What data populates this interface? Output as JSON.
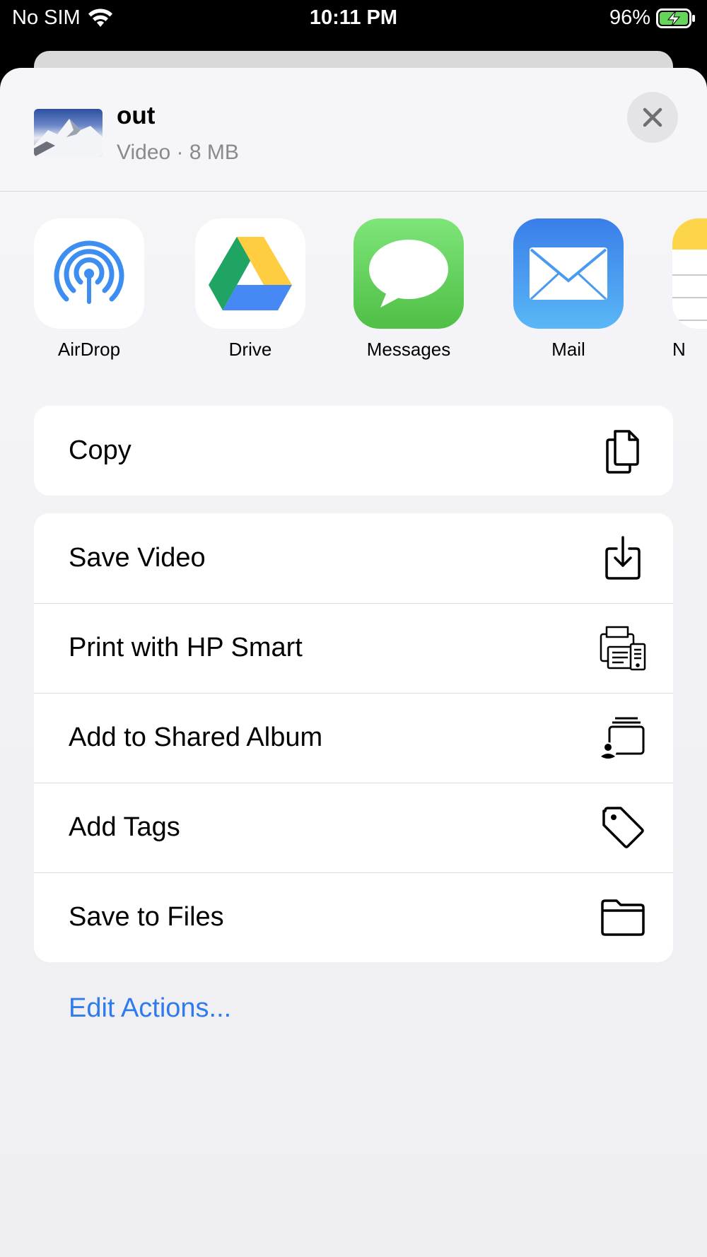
{
  "status_bar": {
    "carrier": "No SIM",
    "time": "10:11 PM",
    "battery": "96%",
    "icons": [
      "wifi-icon",
      "battery-charging-icon"
    ]
  },
  "file": {
    "title": "out",
    "meta": "Video · 8 MB"
  },
  "apps": [
    {
      "label": "AirDrop",
      "icon": "airdrop-icon"
    },
    {
      "label": "Drive",
      "icon": "google-drive-icon"
    },
    {
      "label": "Messages",
      "icon": "messages-icon"
    },
    {
      "label": "Mail",
      "icon": "mail-icon"
    },
    {
      "label": "N",
      "icon": "notes-icon"
    }
  ],
  "actions_primary": [
    {
      "label": "Copy",
      "icon": "copy-icon"
    }
  ],
  "actions_secondary": [
    {
      "label": "Save Video",
      "icon": "download-icon"
    },
    {
      "label": "Print with HP Smart",
      "icon": "printer-icon"
    },
    {
      "label": "Add to Shared Album",
      "icon": "shared-album-icon"
    },
    {
      "label": "Add Tags",
      "icon": "tag-icon"
    },
    {
      "label": "Save to Files",
      "icon": "folder-icon"
    }
  ],
  "edit_actions": "Edit Actions...",
  "colors": {
    "accent": "#2f7be9",
    "sheet_bg": "#f4f4f7",
    "messages_green": "#5ac85a",
    "mail_blue": "#3d8ef0"
  }
}
